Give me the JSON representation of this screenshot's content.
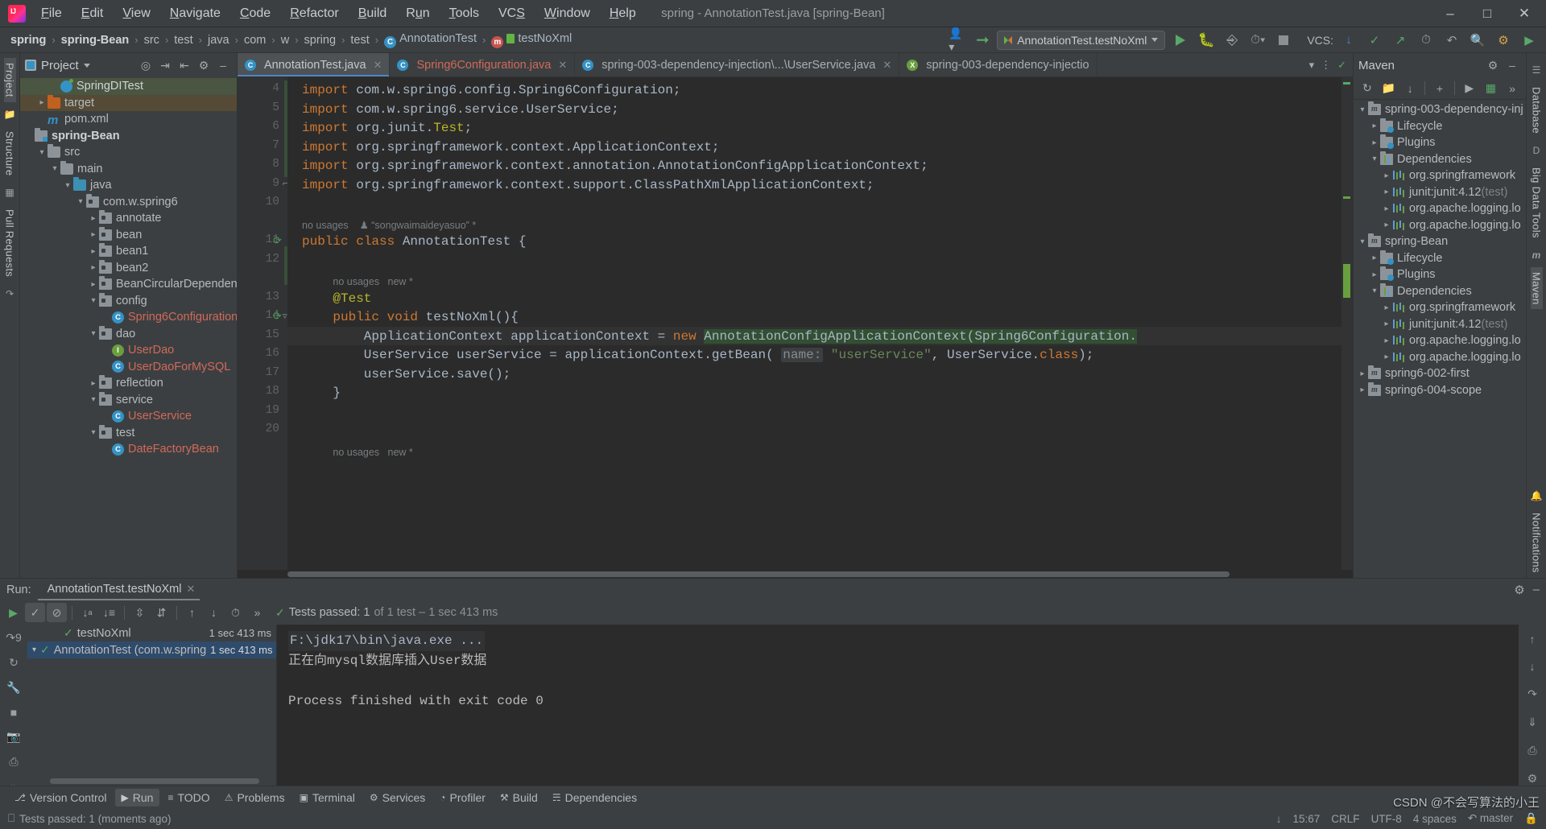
{
  "window": {
    "title": "spring - AnnotationTest.java [spring-Bean]",
    "logo_icon": "intellij-idea-logo",
    "minimize_icon": "minimize-icon",
    "maximize_icon": "maximize-icon",
    "close_icon": "close-icon"
  },
  "menu": [
    {
      "label": "File"
    },
    {
      "label": "Edit"
    },
    {
      "label": "View"
    },
    {
      "label": "Navigate"
    },
    {
      "label": "Code"
    },
    {
      "label": "Refactor"
    },
    {
      "label": "Build"
    },
    {
      "label": "Run"
    },
    {
      "label": "Tools"
    },
    {
      "label": "VCS"
    },
    {
      "label": "Window"
    },
    {
      "label": "Help"
    }
  ],
  "breadcrumb": {
    "items": [
      {
        "label": "spring",
        "style": "bold"
      },
      {
        "label": "spring-Bean",
        "style": "bold"
      },
      {
        "label": "src",
        "style": "plain"
      },
      {
        "label": "test",
        "style": "plain"
      },
      {
        "label": "java",
        "style": "plain"
      },
      {
        "label": "com",
        "style": "plain"
      },
      {
        "label": "w",
        "style": "plain"
      },
      {
        "label": "spring",
        "style": "plain"
      },
      {
        "label": "test",
        "style": "plain"
      },
      {
        "label": "AnnotationTest",
        "style": "class"
      },
      {
        "label": "testNoXml",
        "style": "method"
      }
    ],
    "separator": "›"
  },
  "toolbar": {
    "run_config": "AnnotationTest.testNoXml",
    "run_icon": "run-icon",
    "debug_icon": "debug-icon",
    "coverage_icon": "run-with-coverage-icon",
    "profiler_icon": "profiler-icon",
    "stop_icon": "stop-icon",
    "vcs_label": "VCS:",
    "update_icon": "vcs-update-icon",
    "commit_icon": "vcs-commit-icon",
    "push_icon": "vcs-push-icon",
    "history_icon": "history-icon",
    "rollback_icon": "rollback-icon",
    "search_icon": "search-everywhere-icon",
    "settings_icon": "settings-icon",
    "account_icon": "account-icon",
    "hammer_icon": "build-icon"
  },
  "left_strip": [
    {
      "label": "Project",
      "active": true
    },
    {
      "label": "Structure",
      "active": false
    },
    {
      "label": "Pull Requests",
      "active": false
    }
  ],
  "right_strip": [
    {
      "label": "Database"
    },
    {
      "label": "Big Data Tools"
    },
    {
      "label": "Maven"
    },
    {
      "label": "Notifications"
    }
  ],
  "project_panel": {
    "title": "Project",
    "locate_icon": "locate-icon",
    "expand_icon": "expand-all-icon",
    "collapse_icon": "collapse-all-icon",
    "settings_icon": "gear-icon",
    "hide_icon": "hide-icon",
    "tree": [
      {
        "indent": 2,
        "arrow": "",
        "icon": "spring-icon",
        "label": "SpringDITest",
        "style": "white",
        "row": "sel-green"
      },
      {
        "indent": 1,
        "arrow": "›",
        "icon": "folder-orange",
        "label": "target",
        "style": "plain",
        "row": "sel-brown"
      },
      {
        "indent": 1,
        "arrow": "",
        "icon": "maven-icon",
        "label": "pom.xml",
        "style": "plain",
        "row": ""
      },
      {
        "indent": 0,
        "arrow": "",
        "icon": "module-icon",
        "label": "spring-Bean",
        "style": "bold",
        "row": ""
      },
      {
        "indent": 1,
        "arrow": "⌄",
        "icon": "folder",
        "label": "src",
        "style": "plain",
        "row": ""
      },
      {
        "indent": 2,
        "arrow": "⌄",
        "icon": "folder",
        "label": "main",
        "style": "plain",
        "row": ""
      },
      {
        "indent": 3,
        "arrow": "⌄",
        "icon": "folder-blue",
        "label": "java",
        "style": "plain",
        "row": ""
      },
      {
        "indent": 4,
        "arrow": "⌄",
        "icon": "package-icon",
        "label": "com.w.spring6",
        "style": "plain",
        "row": ""
      },
      {
        "indent": 5,
        "arrow": "›",
        "icon": "package-icon",
        "label": "annotate",
        "style": "plain",
        "row": ""
      },
      {
        "indent": 5,
        "arrow": "›",
        "icon": "package-icon",
        "label": "bean",
        "style": "plain",
        "row": ""
      },
      {
        "indent": 5,
        "arrow": "›",
        "icon": "package-icon",
        "label": "bean1",
        "style": "plain",
        "row": ""
      },
      {
        "indent": 5,
        "arrow": "›",
        "icon": "package-icon",
        "label": "bean2",
        "style": "plain",
        "row": ""
      },
      {
        "indent": 5,
        "arrow": "›",
        "icon": "package-icon",
        "label": "BeanCircularDependency",
        "style": "plain",
        "row": ""
      },
      {
        "indent": 5,
        "arrow": "⌄",
        "icon": "package-icon",
        "label": "config",
        "style": "plain",
        "row": ""
      },
      {
        "indent": 6,
        "arrow": "",
        "icon": "class-badge",
        "label": "Spring6Configuration",
        "style": "red",
        "row": ""
      },
      {
        "indent": 5,
        "arrow": "⌄",
        "icon": "package-icon",
        "label": "dao",
        "style": "plain",
        "row": ""
      },
      {
        "indent": 6,
        "arrow": "",
        "icon": "interface-badge",
        "label": "UserDao",
        "style": "red",
        "row": ""
      },
      {
        "indent": 6,
        "arrow": "",
        "icon": "class-badge",
        "label": "UserDaoForMySQL",
        "style": "red",
        "row": ""
      },
      {
        "indent": 5,
        "arrow": "›",
        "icon": "package-icon",
        "label": "reflection",
        "style": "plain",
        "row": ""
      },
      {
        "indent": 5,
        "arrow": "⌄",
        "icon": "package-icon",
        "label": "service",
        "style": "plain",
        "row": ""
      },
      {
        "indent": 6,
        "arrow": "",
        "icon": "class-badge",
        "label": "UserService",
        "style": "red",
        "row": ""
      },
      {
        "indent": 5,
        "arrow": "⌄",
        "icon": "package-icon",
        "label": "test",
        "style": "plain",
        "row": ""
      },
      {
        "indent": 6,
        "arrow": "",
        "icon": "class-badge",
        "label": "DateFactoryBean",
        "style": "red",
        "row": ""
      }
    ]
  },
  "editor": {
    "tabs": [
      {
        "label": "AnnotationTest.java",
        "icon": "class-icon",
        "active": true,
        "red": false
      },
      {
        "label": "Spring6Configuration.java",
        "icon": "class-icon",
        "active": false,
        "red": true
      },
      {
        "label": "spring-003-dependency-injection\\...\\UserService.java",
        "icon": "class-icon",
        "active": false,
        "red": false
      },
      {
        "label": "spring-003-dependency-injectio",
        "icon": "xml-icon",
        "active": false,
        "red": false
      }
    ],
    "more_icon": "chevron-down-icon",
    "menu_icon": "tab-options-icon",
    "check_icon": "inspection-ok-icon",
    "lines": [
      {
        "num": "4",
        "indent": 0,
        "tokens": [
          {
            "t": "import ",
            "c": "k"
          },
          {
            "t": "com.w.spring6.config.Spring6Configuration;",
            "c": "id"
          }
        ]
      },
      {
        "num": "5",
        "indent": 0,
        "tokens": [
          {
            "t": "import ",
            "c": "k"
          },
          {
            "t": "com.w.spring6.service.UserService;",
            "c": "id"
          }
        ]
      },
      {
        "num": "6",
        "indent": 0,
        "tokens": [
          {
            "t": "import ",
            "c": "k"
          },
          {
            "t": "org.junit.",
            "c": "id"
          },
          {
            "t": "Test",
            "c": "an"
          },
          {
            "t": ";",
            "c": "id"
          }
        ]
      },
      {
        "num": "7",
        "indent": 0,
        "tokens": [
          {
            "t": "import ",
            "c": "k"
          },
          {
            "t": "org.springframework.context.ApplicationContext;",
            "c": "id"
          }
        ]
      },
      {
        "num": "8",
        "indent": 0,
        "tokens": [
          {
            "t": "import ",
            "c": "k"
          },
          {
            "t": "org.springframework.context.annotation.AnnotationConfigApplicationContext;",
            "c": "id"
          }
        ]
      },
      {
        "num": "9",
        "indent": 0,
        "tokens": [
          {
            "t": "import ",
            "c": "k"
          },
          {
            "t": "org.springframework.context.support.ClassPathXmlApplicationContext;",
            "c": "id"
          }
        ]
      },
      {
        "num": "10",
        "indent": 0,
        "tokens": []
      },
      {
        "num": "",
        "indent": 0,
        "hint": "no usages    ♟ “songwaimaideyasuo” *"
      },
      {
        "num": "11",
        "indent": 0,
        "tokens": [
          {
            "t": "public class ",
            "c": "k"
          },
          {
            "t": "AnnotationTest ",
            "c": "id"
          },
          {
            "t": "{",
            "c": "id"
          }
        ]
      },
      {
        "num": "12",
        "indent": 0,
        "tokens": []
      },
      {
        "num": "",
        "indent": 4,
        "hint": "no usages   new *"
      },
      {
        "num": "13",
        "indent": 4,
        "tokens": [
          {
            "t": "@Test",
            "c": "an"
          }
        ]
      },
      {
        "num": "14",
        "indent": 4,
        "tokens": [
          {
            "t": "public void ",
            "c": "k"
          },
          {
            "t": "testNoXml",
            "c": "id"
          },
          {
            "t": "(){",
            "c": "id"
          }
        ]
      },
      {
        "num": "15",
        "indent": 8,
        "tokens": [
          {
            "t": "ApplicationContext applicationContext = ",
            "c": "id"
          },
          {
            "t": "new ",
            "c": "k"
          },
          {
            "t": "AnnotationConfigApplicationContext(Spring6Configuration.",
            "c": "id"
          }
        ]
      },
      {
        "num": "16",
        "indent": 8,
        "tokens": [
          {
            "t": "UserService userService = applicationContext.getBean( ",
            "c": "id"
          },
          {
            "t": "name:",
            "c": "prm"
          },
          {
            "t": " ",
            "c": "id"
          },
          {
            "t": "\"userService\"",
            "c": "s"
          },
          {
            "t": ", UserService.",
            "c": "id"
          },
          {
            "t": "class",
            "c": "k"
          },
          {
            "t": ");",
            "c": "id"
          }
        ]
      },
      {
        "num": "17",
        "indent": 8,
        "tokens": [
          {
            "t": "userService.save();",
            "c": "id"
          }
        ]
      },
      {
        "num": "18",
        "indent": 4,
        "tokens": [
          {
            "t": "}",
            "c": "id"
          }
        ]
      },
      {
        "num": "19",
        "indent": 0,
        "tokens": []
      },
      {
        "num": "20",
        "indent": 0,
        "tokens": []
      },
      {
        "num": "",
        "indent": 4,
        "hint": "no usages   new *"
      }
    ]
  },
  "maven_panel": {
    "title": "Maven",
    "settings_icon": "gear-icon",
    "hide_icon": "hide-icon",
    "reload_icon": "reload-icon",
    "add_module_icon": "add-maven-project-icon",
    "download_icon": "download-sources-icon",
    "add_icon": "add-icon",
    "execute_icon": "execute-goal-icon",
    "run_icon": "run-icon",
    "more_icon": "more-icon",
    "tree": [
      {
        "indent": 0,
        "arrow": "⌄",
        "icon": "maven-module-icon",
        "label": "spring-003-dependency-inj",
        "dim": ""
      },
      {
        "indent": 1,
        "arrow": "›",
        "icon": "config-folder-icon",
        "label": "Lifecycle",
        "dim": ""
      },
      {
        "indent": 1,
        "arrow": "›",
        "icon": "config-folder-icon",
        "label": "Plugins",
        "dim": ""
      },
      {
        "indent": 1,
        "arrow": "⌄",
        "icon": "deps-folder-icon",
        "label": "Dependencies",
        "dim": ""
      },
      {
        "indent": 2,
        "arrow": "›",
        "icon": "library-icon",
        "label": "org.springframework",
        "dim": ""
      },
      {
        "indent": 2,
        "arrow": "›",
        "icon": "library-icon",
        "label": "junit:junit:4.12",
        "dim": "(test)"
      },
      {
        "indent": 2,
        "arrow": "›",
        "icon": "library-icon",
        "label": "org.apache.logging.lo",
        "dim": ""
      },
      {
        "indent": 2,
        "arrow": "›",
        "icon": "library-icon",
        "label": "org.apache.logging.lo",
        "dim": ""
      },
      {
        "indent": 0,
        "arrow": "⌄",
        "icon": "maven-module-icon",
        "label": "spring-Bean",
        "dim": ""
      },
      {
        "indent": 1,
        "arrow": "›",
        "icon": "config-folder-icon",
        "label": "Lifecycle",
        "dim": ""
      },
      {
        "indent": 1,
        "arrow": "›",
        "icon": "config-folder-icon",
        "label": "Plugins",
        "dim": ""
      },
      {
        "indent": 1,
        "arrow": "⌄",
        "icon": "deps-folder-icon",
        "label": "Dependencies",
        "dim": ""
      },
      {
        "indent": 2,
        "arrow": "›",
        "icon": "library-icon",
        "label": "org.springframework",
        "dim": ""
      },
      {
        "indent": 2,
        "arrow": "›",
        "icon": "library-icon",
        "label": "junit:junit:4.12",
        "dim": "(test)"
      },
      {
        "indent": 2,
        "arrow": "›",
        "icon": "library-icon",
        "label": "org.apache.logging.lo",
        "dim": ""
      },
      {
        "indent": 2,
        "arrow": "›",
        "icon": "library-icon",
        "label": "org.apache.logging.lo",
        "dim": ""
      },
      {
        "indent": 0,
        "arrow": "›",
        "icon": "maven-module-icon",
        "label": "spring6-002-first",
        "dim": ""
      },
      {
        "indent": 0,
        "arrow": "›",
        "icon": "maven-module-icon",
        "label": "spring6-004-scope",
        "dim": ""
      }
    ]
  },
  "run_panel": {
    "label": "Run:",
    "tab_title": "AnnotationTest.testNoXml",
    "tab_icon": "run-config-icon",
    "close_icon": "close-icon",
    "settings_icon": "gear-icon",
    "hide_icon": "hide-icon",
    "toolbar": {
      "rerun_icon": "rerun-icon",
      "show_passed_icon": "show-passed-icon",
      "show_ignored_icon": "show-ignored-icon",
      "sort_alpha_icon": "sort-alphabetically-icon",
      "sort_duration_icon": "sort-by-duration-icon",
      "expand_icon": "expand-all-icon",
      "collapse_icon": "collapse-all-icon",
      "prev_icon": "previous-failed-icon",
      "next_icon": "next-failed-icon",
      "history_icon": "test-history-icon",
      "more_icon": "more-icon"
    },
    "status": {
      "icon": "check-icon",
      "text": "Tests passed: 1",
      "detail": "of 1 test – 1 sec 413 ms"
    },
    "tree": [
      {
        "indent": 0,
        "arrow": "⌄",
        "label": "AnnotationTest (com.w.spring",
        "time": "1 sec 413 ms",
        "selected": true
      },
      {
        "indent": 1,
        "arrow": "",
        "label": "testNoXml",
        "time": "1 sec 413 ms",
        "selected": false
      }
    ],
    "console": [
      {
        "text": "F:\\jdk17\\bin\\java.exe ...",
        "style": "cmd"
      },
      {
        "text": "正在向mysql数据库插入User数据",
        "style": "plain"
      },
      {
        "text": "",
        "style": "plain"
      },
      {
        "text": "Process finished with exit code 0",
        "style": "plain"
      }
    ],
    "side_icons": [
      "debug-icon",
      "rerun-icon",
      "wrench-icon",
      "stop-icon",
      "camera-icon",
      "print-icon",
      "more-icon"
    ],
    "console_icons": [
      "scroll-up-icon",
      "scroll-down-icon",
      "soft-wrap-icon",
      "export-icon",
      "print-icon"
    ]
  },
  "tool_buttons": [
    {
      "label": "Version Control",
      "icon": "vcs-icon",
      "active": false
    },
    {
      "label": "Run",
      "icon": "run-icon",
      "active": true
    },
    {
      "label": "TODO",
      "icon": "todo-icon",
      "active": false
    },
    {
      "label": "Problems",
      "icon": "problems-icon",
      "active": false
    },
    {
      "label": "Terminal",
      "icon": "terminal-icon",
      "active": false
    },
    {
      "label": "Services",
      "icon": "services-icon",
      "active": false
    },
    {
      "label": "Profiler",
      "icon": "profiler-icon",
      "active": false
    },
    {
      "label": "Build",
      "icon": "build-icon",
      "active": false
    },
    {
      "label": "Dependencies",
      "icon": "dependencies-icon",
      "active": false
    }
  ],
  "status_bar": {
    "icon": "event-log-icon",
    "message": "Tests passed: 1 (moments ago)",
    "download_icon": "download-icon",
    "position": "15:67",
    "line_sep": "CRLF",
    "encoding": "UTF-8",
    "indent": "4 spaces",
    "branch_icon": "branch-icon",
    "branch": "master",
    "lock_icon": "lock-icon"
  },
  "watermark": "CSDN @不会写算法的小王",
  "colors": {
    "accent_blue": "#4a88c7",
    "green": "#59a869",
    "red": "#cf6a5a",
    "orange": "#cc7832",
    "bg_panel": "#3c3f41",
    "bg_editor": "#2b2b2b"
  }
}
